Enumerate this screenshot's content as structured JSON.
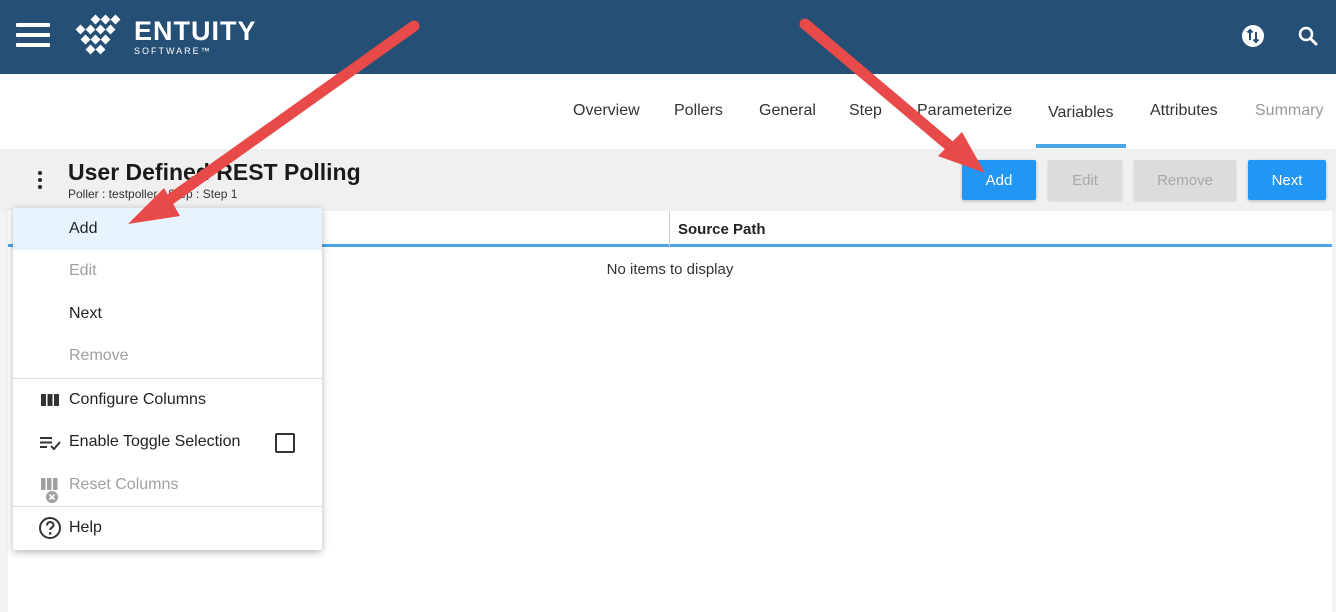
{
  "header": {
    "logo_text": "ENTUITY",
    "logo_sub": "SOFTWARE™",
    "brand_color": "#254f74",
    "icons": [
      "menu-icon",
      "swap-icon",
      "search-icon"
    ]
  },
  "tabs": [
    {
      "label": "Overview",
      "state": "normal"
    },
    {
      "label": "Pollers",
      "state": "normal"
    },
    {
      "label": "General",
      "state": "normal"
    },
    {
      "label": "Step",
      "state": "normal"
    },
    {
      "label": "Parameterize",
      "state": "normal"
    },
    {
      "label": "Variables",
      "state": "selected"
    },
    {
      "label": "Attributes",
      "state": "normal"
    },
    {
      "label": "Summary",
      "state": "disabled"
    }
  ],
  "page": {
    "title": "User Defined REST Polling",
    "subtitle": "Poller : testpoller · Step : Step 1"
  },
  "toolbar": {
    "add_label": "Add",
    "edit_label": "Edit",
    "remove_label": "Remove",
    "next_label": "Next",
    "accent_color": "#2196f3"
  },
  "grid": {
    "columns": [
      "",
      "Source Path"
    ],
    "empty_message": "No items to display"
  },
  "menu": {
    "items": [
      {
        "label": "Add",
        "state": "highlighted",
        "icon": ""
      },
      {
        "label": "Edit",
        "state": "disabled",
        "icon": ""
      },
      {
        "label": "Next",
        "state": "normal",
        "icon": ""
      },
      {
        "label": "Remove",
        "state": "disabled",
        "icon": ""
      },
      {
        "label": "Configure Columns",
        "state": "normal",
        "icon": "columns-icon"
      },
      {
        "label": "Enable Toggle Selection",
        "state": "normal",
        "icon": "list-check-icon",
        "checked": false
      },
      {
        "label": "Reset Columns",
        "state": "disabled",
        "icon": "reset-columns-icon"
      },
      {
        "label": "Help",
        "state": "normal",
        "icon": "help-icon"
      }
    ]
  },
  "annotation": {
    "arrow_color": "#e84a4a"
  }
}
